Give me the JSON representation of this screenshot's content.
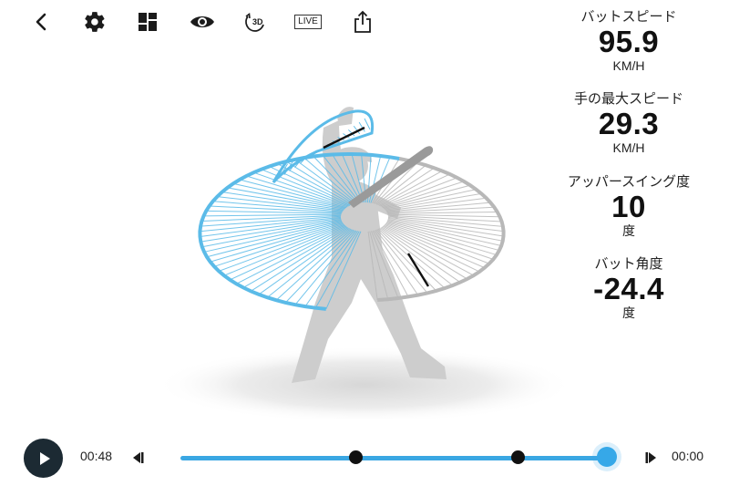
{
  "toolbar": {
    "items": [
      {
        "icon": "back-icon"
      },
      {
        "icon": "gear-icon"
      },
      {
        "icon": "layout-icon"
      },
      {
        "icon": "eye-icon"
      },
      {
        "icon": "rotate-3d-icon",
        "label": "3D"
      },
      {
        "icon": "live-icon",
        "label": "LIVE"
      },
      {
        "icon": "share-icon"
      }
    ]
  },
  "metrics": [
    {
      "label": "バットスピード",
      "value": "95.9",
      "unit": "KM/H"
    },
    {
      "label": "手の最大スピード",
      "value": "29.3",
      "unit": "KM/H"
    },
    {
      "label": "アッパースイング度",
      "value": "10",
      "unit": "度"
    },
    {
      "label": "バット角度",
      "value": "-24.4",
      "unit": "度"
    }
  ],
  "player": {
    "elapsed": "00:48",
    "remaining": "00:00",
    "markers": [
      0.41,
      0.79
    ],
    "progress": 1.0
  },
  "colors": {
    "accent": "#36a8e8",
    "dark": "#1c2a33",
    "swing_blue": "#5bbbe8",
    "swing_gray": "#b8b8b8"
  }
}
